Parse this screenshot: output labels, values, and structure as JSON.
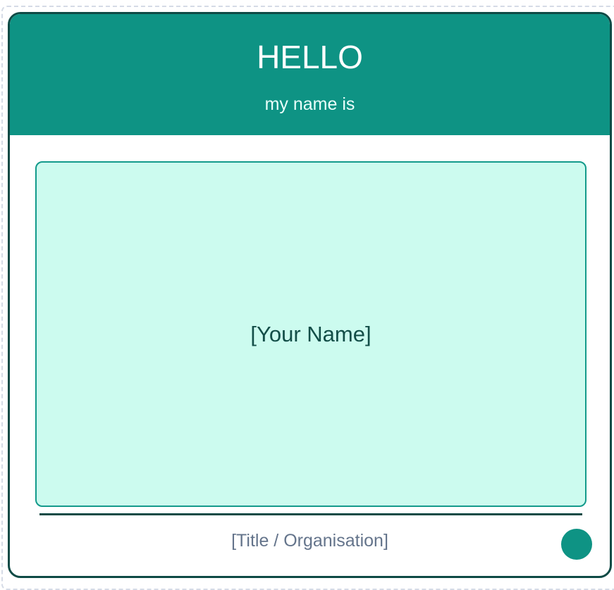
{
  "badge": {
    "greeting": "HELLO",
    "subheading": "my name is",
    "name_placeholder": "[Your Name]",
    "org_placeholder": "[Title / Organisation]",
    "colors": {
      "header": "#0e9384",
      "border": "#0e4a45",
      "name_box": "#ccfbef",
      "dot": "#0e9384"
    }
  }
}
